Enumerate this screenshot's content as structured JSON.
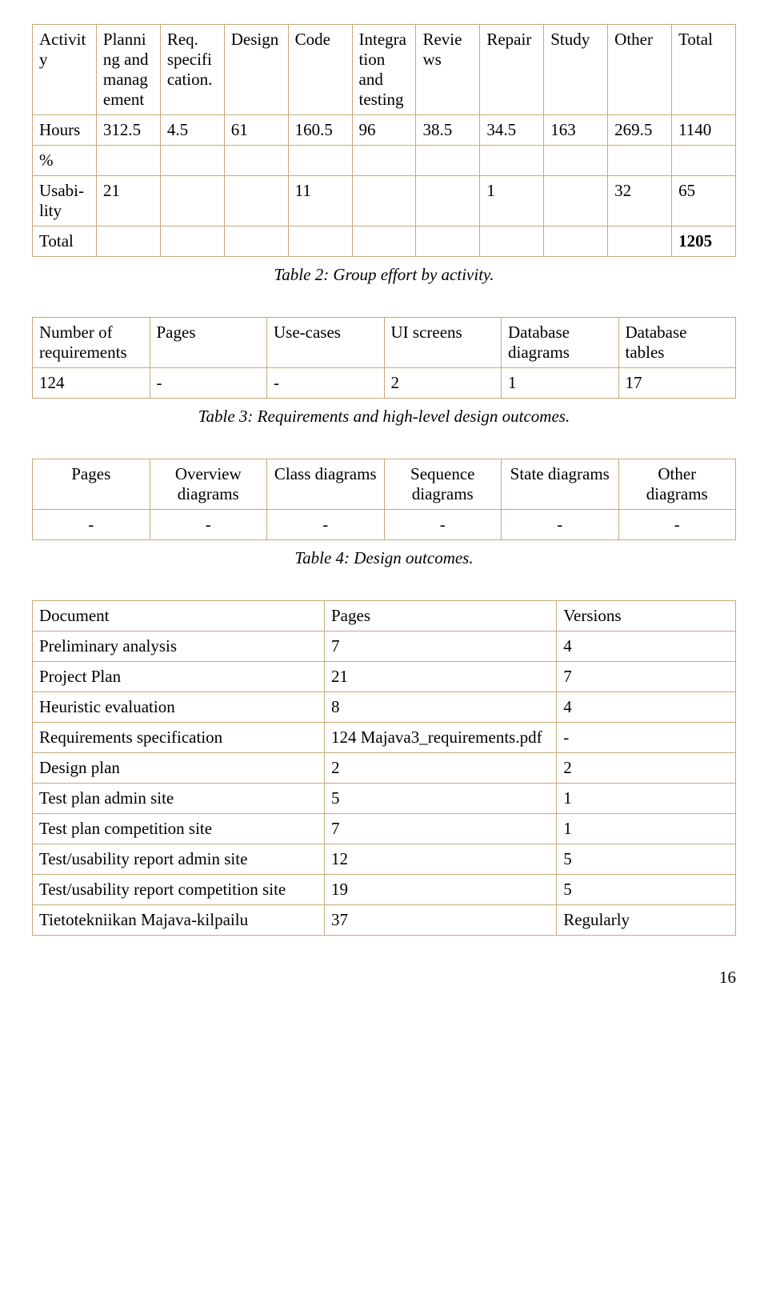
{
  "table2": {
    "headers": [
      "Activity",
      "Planning and management",
      "Req. specification.",
      "Design",
      "Code",
      "Integration and testing",
      "Reviews",
      "Repair",
      "Study",
      "Other",
      "Total"
    ],
    "rows": [
      [
        "Hours",
        "312.5",
        "4.5",
        "61",
        "160.5",
        "96",
        "38.5",
        "34.5",
        "163",
        "269.5",
        "1140"
      ],
      [
        "%",
        "",
        "",
        "",
        "",
        "",
        "",
        "",
        "",
        "",
        ""
      ],
      [
        "Usabi-lity",
        "21",
        "",
        "",
        "11",
        "",
        "",
        "1",
        "",
        "32",
        "65"
      ],
      [
        "Total",
        "",
        "",
        "",
        "",
        "",
        "",
        "",
        "",
        "",
        "1205"
      ]
    ],
    "caption": "Table 2: Group effort by activity."
  },
  "table3": {
    "headers": [
      "Number of requirements",
      "Pages",
      "Use-cases",
      "UI screens",
      "Database diagrams",
      "Database tables"
    ],
    "rows": [
      [
        "124",
        "-",
        "-",
        "2",
        "1",
        "17"
      ]
    ],
    "caption": "Table 3: Requirements and high-level design outcomes."
  },
  "table4": {
    "headers": [
      "Pages",
      "Overview diagrams",
      "Class diagrams",
      "Sequence diagrams",
      "State diagrams",
      "Other diagrams"
    ],
    "rows": [
      [
        "-",
        "-",
        "-",
        "-",
        "-",
        "-"
      ]
    ],
    "caption": "Table 4: Design outcomes."
  },
  "table5": {
    "headers": [
      "Document",
      "Pages",
      "Versions"
    ],
    "rows": [
      [
        "Preliminary analysis",
        "7",
        "4"
      ],
      [
        "Project Plan",
        "21",
        "7"
      ],
      [
        "Heuristic evaluation",
        "8",
        "4"
      ],
      [
        "Requirements specification",
        "124 Majava3_requirements.pdf",
        "-"
      ],
      [
        "Design plan",
        "2",
        "2"
      ],
      [
        "Test plan admin site",
        "5",
        "1"
      ],
      [
        "Test plan competition site",
        "7",
        "1"
      ],
      [
        "Test/usability report admin site",
        "12",
        "5"
      ],
      [
        "Test/usability report competition site",
        "19",
        "5"
      ],
      [
        "Tietotekniikan Majava-kilpailu",
        "37",
        "Regularly"
      ]
    ]
  },
  "pagenum": "16"
}
